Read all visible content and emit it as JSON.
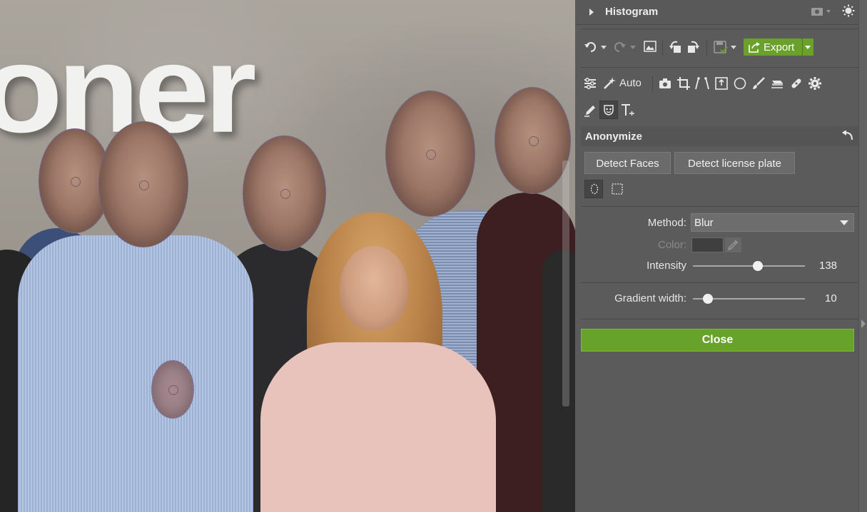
{
  "canvas": {
    "logo_text": "oner"
  },
  "panel": {
    "histogram": {
      "title": "Histogram"
    },
    "toolbar": {
      "export_label": "Export",
      "auto_label": "Auto"
    },
    "anonymize": {
      "title": "Anonymize",
      "detect_faces": "Detect Faces",
      "detect_plate": "Detect license plate",
      "method_label": "Method:",
      "method_value": "Blur",
      "color_label": "Color:",
      "intensity_label": "Intensity",
      "intensity_value": "138",
      "intensity_level": 0.69,
      "gradient_label": "Gradient width:",
      "gradient_value": "10",
      "gradient_level": 0.08,
      "close_label": "Close"
    }
  },
  "icons": [
    "histogram-camera-icon",
    "settings-sun-icon",
    "undo-icon",
    "redo-icon",
    "image-icon",
    "rotate-left-icon",
    "rotate-right-icon",
    "save-icon",
    "export-icon",
    "adjust-sliders-icon",
    "magic-wand-icon",
    "camera-icon",
    "crop-icon",
    "perspective-icon",
    "frame-icon",
    "circle-icon",
    "brush-icon",
    "eraser-icon",
    "bandage-icon",
    "gear-icon",
    "pencil-icon",
    "mask-icon",
    "text-icon",
    "reset-arrow-icon",
    "eyedropper-icon"
  ],
  "colors": {
    "accent": "#6aa12b",
    "panel_bg": "#5b5b5b",
    "face_outline": "#6a68a8"
  }
}
